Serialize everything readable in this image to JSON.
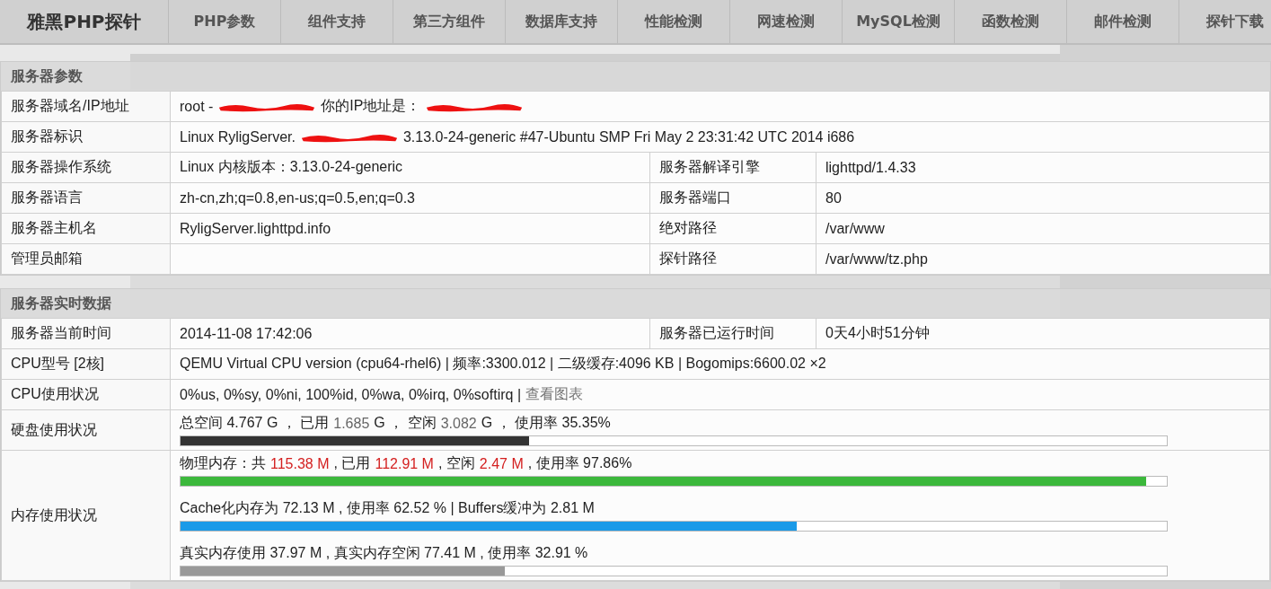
{
  "nav": {
    "brand": "雅黑PHP探针",
    "tabs": [
      "PHP参数",
      "组件支持",
      "第三方组件",
      "数据库支持",
      "性能检测",
      "网速检测",
      "MySQL检测",
      "函数检测",
      "邮件检测",
      "探针下载"
    ]
  },
  "sections": [
    {
      "title": "服务器参数",
      "rows": [
        {
          "kind": "wide",
          "label": "服务器域名/IP地址",
          "parts": [
            {
              "kind": "text",
              "text": "root -"
            },
            {
              "kind": "redacted"
            },
            {
              "kind": "text",
              "text": "你的IP地址是："
            },
            {
              "kind": "redacted"
            }
          ]
        },
        {
          "kind": "wide",
          "label": "服务器标识",
          "parts": [
            {
              "kind": "text",
              "text": "Linux RyligServer."
            },
            {
              "kind": "redacted"
            },
            {
              "kind": "text",
              "text": "3.13.0-24-generic #47-Ubuntu SMP Fri May 2 23:31:42 UTC 2014 i686"
            }
          ]
        },
        {
          "kind": "pair",
          "label": "服务器操作系统",
          "value": "Linux  内核版本：3.13.0-24-generic",
          "label2": "服务器解译引擎",
          "value2": "lighttpd/1.4.33"
        },
        {
          "kind": "pair",
          "label": "服务器语言",
          "value": "zh-cn,zh;q=0.8,en-us;q=0.5,en;q=0.3",
          "label2": "服务器端口",
          "value2": "80"
        },
        {
          "kind": "pair",
          "label": "服务器主机名",
          "value": "RyligServer.lighttpd.info",
          "label2": "绝对路径",
          "value2": "/var/www"
        },
        {
          "kind": "pair",
          "label": "管理员邮箱",
          "label2": "探针路径",
          "value2": "/var/www/tz.php"
        }
      ]
    },
    {
      "title": "服务器实时数据",
      "rows": [
        {
          "kind": "pair",
          "label": "服务器当前时间",
          "value": "2014-11-08 17:42:06",
          "label2": "服务器已运行时间",
          "value2": "0天4小时51分钟"
        },
        {
          "kind": "wide",
          "label": "CPU型号 [2核]",
          "parts": [
            {
              "kind": "text",
              "text": "QEMU Virtual CPU version (cpu64-rhel6) | 频率:3300.012 | 二级缓存:4096 KB | Bogomips:6600.02 ×2"
            }
          ]
        },
        {
          "kind": "wide",
          "label": "CPU使用状况",
          "parts": [
            {
              "kind": "text",
              "text": "0%us, 0%sy, 0%ni, 100%id, 0%wa, 0%irq, 0%softirq |"
            },
            {
              "kind": "link",
              "text": "查看图表"
            }
          ]
        },
        {
          "kind": "bars",
          "label": "硬盘使用状况",
          "bars": [
            {
              "parts": [
                {
                  "kind": "text",
                  "text": "总空间 4.767 G ， 已用"
                },
                {
                  "kind": "muted",
                  "text": "1.685"
                },
                {
                  "kind": "text",
                  "text": "G ， 空闲"
                },
                {
                  "kind": "muted",
                  "text": "3.082"
                },
                {
                  "kind": "text",
                  "text": "G ， 使用率 35.35%"
                }
              ],
              "level": 0.3535,
              "color": "#333333"
            }
          ]
        },
        {
          "kind": "bars",
          "label": "内存使用状况",
          "bars": [
            {
              "parts": [
                {
                  "kind": "text",
                  "text": "物理内存：共"
                },
                {
                  "kind": "red",
                  "text": "115.38 M"
                },
                {
                  "kind": "text",
                  "text": ", 已用"
                },
                {
                  "kind": "red",
                  "text": "112.91 M"
                },
                {
                  "kind": "text",
                  "text": ", 空闲"
                },
                {
                  "kind": "red",
                  "text": "2.47 M"
                },
                {
                  "kind": "text",
                  "text": ", 使用率 97.86%"
                }
              ],
              "level": 0.9786,
              "color": "#3cb83c"
            },
            {
              "parts": [
                {
                  "kind": "text",
                  "text": "Cache化内存为 72.13 M , 使用率 62.52 % | Buffers缓冲为 2.81 M"
                }
              ],
              "level": 0.6252,
              "color": "#1a9ae8"
            },
            {
              "parts": [
                {
                  "kind": "text",
                  "text": "真实内存使用 37.97 M , 真实内存空闲 77.41 M , 使用率 32.91 %"
                }
              ],
              "level": 0.3291,
              "color": "#999999"
            }
          ]
        }
      ]
    }
  ]
}
